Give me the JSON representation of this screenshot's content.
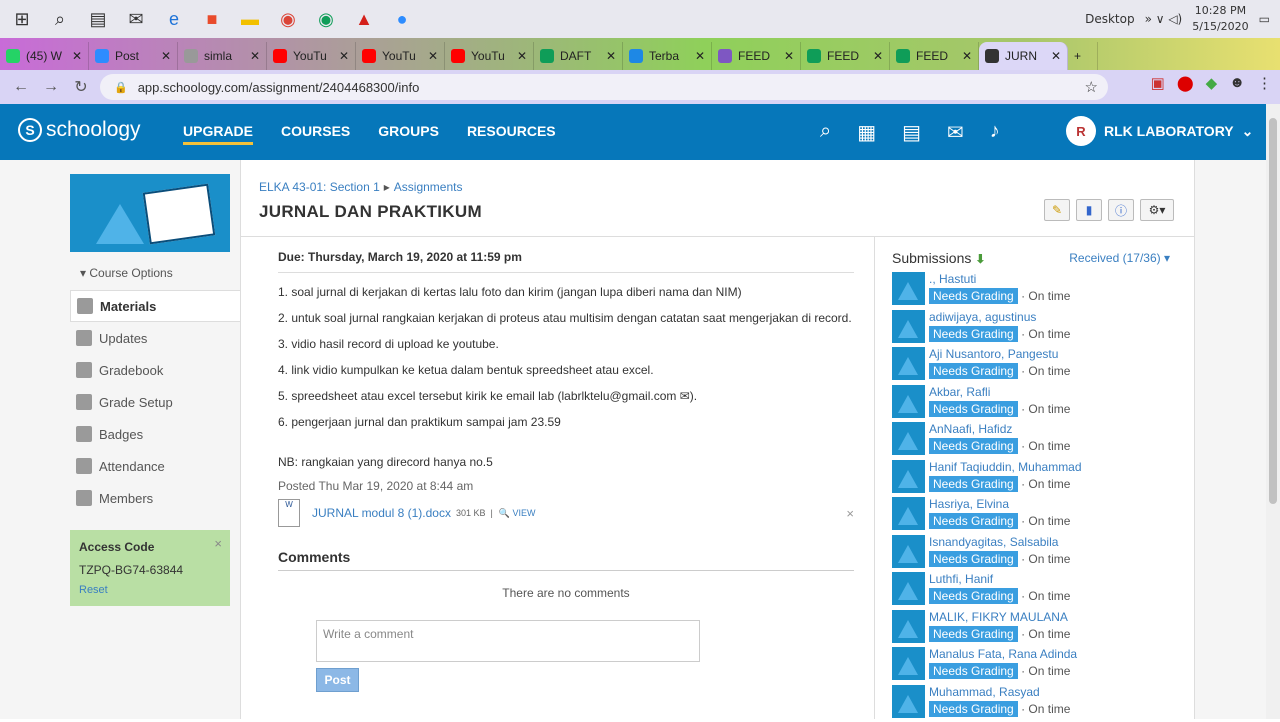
{
  "taskbar": {
    "desktop_label": "Desktop",
    "time": "10:28 PM",
    "date": "5/15/2020"
  },
  "tabs": [
    {
      "label": "(45) W",
      "color": "#25d366"
    },
    {
      "label": "Post",
      "color": "#2d8cff"
    },
    {
      "label": "simla",
      "color": "#999999"
    },
    {
      "label": "YouTu",
      "color": "#ff0000"
    },
    {
      "label": "YouTu",
      "color": "#ff0000"
    },
    {
      "label": "YouTu",
      "color": "#ff0000"
    },
    {
      "label": "DAFT",
      "color": "#0f9d58"
    },
    {
      "label": "Terba",
      "color": "#1e88e5"
    },
    {
      "label": "FEED",
      "color": "#7e57c2"
    },
    {
      "label": "FEED",
      "color": "#0f9d58"
    },
    {
      "label": "FEED",
      "color": "#0f9d58"
    },
    {
      "label": "JURN",
      "color": "#333333"
    }
  ],
  "url": "app.schoology.com/assignment/2404468300/info",
  "header": {
    "logo": "schoology",
    "menu": [
      "UPGRADE",
      "COURSES",
      "GROUPS",
      "RESOURCES"
    ],
    "user": "RLK LABORATORY"
  },
  "sidebar": {
    "course_options": "Course Options",
    "items": [
      "Materials",
      "Updates",
      "Gradebook",
      "Grade Setup",
      "Badges",
      "Attendance",
      "Members"
    ],
    "access": {
      "title": "Access Code",
      "code": "TZPQ-BG74-63844",
      "reset": "Reset"
    }
  },
  "assignment": {
    "breadcrumb_course": "ELKA 43-01: Section 1",
    "breadcrumb_section": "Assignments",
    "title": "JURNAL DAN PRAKTIKUM",
    "due": "Due: Thursday, March 19, 2020 at 11:59 pm",
    "lines": [
      "1. soal jurnal di kerjakan di kertas lalu foto dan kirim (jangan lupa diberi nama dan NIM)",
      "2. untuk soal jurnal rangkaian kerjakan di proteus atau multisim dengan catatan saat mengerjakan di record.",
      "3. vidio hasil record di upload ke youtube.",
      "4. link vidio kumpulkan ke ketua dalam bentuk spreedsheet atau excel.",
      "5. spreedsheet atau excel tersebut kirik ke email lab (labrlktelu@gmail.com ✉).",
      "6. pengerjaan jurnal dan praktikum sampai jam 23.59"
    ],
    "note": "NB: rangkaian yang direcord hanya no.5",
    "posted": "Posted Thu Mar 19, 2020 at 8:44 am",
    "attachment": {
      "name": "JURNAL modul 8 (1).docx",
      "size": "301 KB",
      "view": "VIEW"
    },
    "comments_title": "Comments",
    "no_comments": "There are no comments",
    "comment_placeholder": "Write a comment",
    "post_label": "Post"
  },
  "submissions": {
    "title": "Submissions",
    "received": "Received (17/36) ▾",
    "badge": "Needs Grading",
    "status": "· On time",
    "students": [
      "., Hastuti",
      "adiwijaya, agustinus",
      "Aji Nusantoro, Pangestu",
      "Akbar, Rafli",
      "AnNaafi, Hafidz",
      "Hanif Taqiuddin, Muhammad",
      "Hasriya, Elvina",
      "Isnandyagitas, Salsabila",
      "Luthfi, Hanif",
      "MALIK, FIKRY MAULANA",
      "Manalus Fata, Rana Adinda",
      "Muhammad, Rasyad"
    ]
  }
}
